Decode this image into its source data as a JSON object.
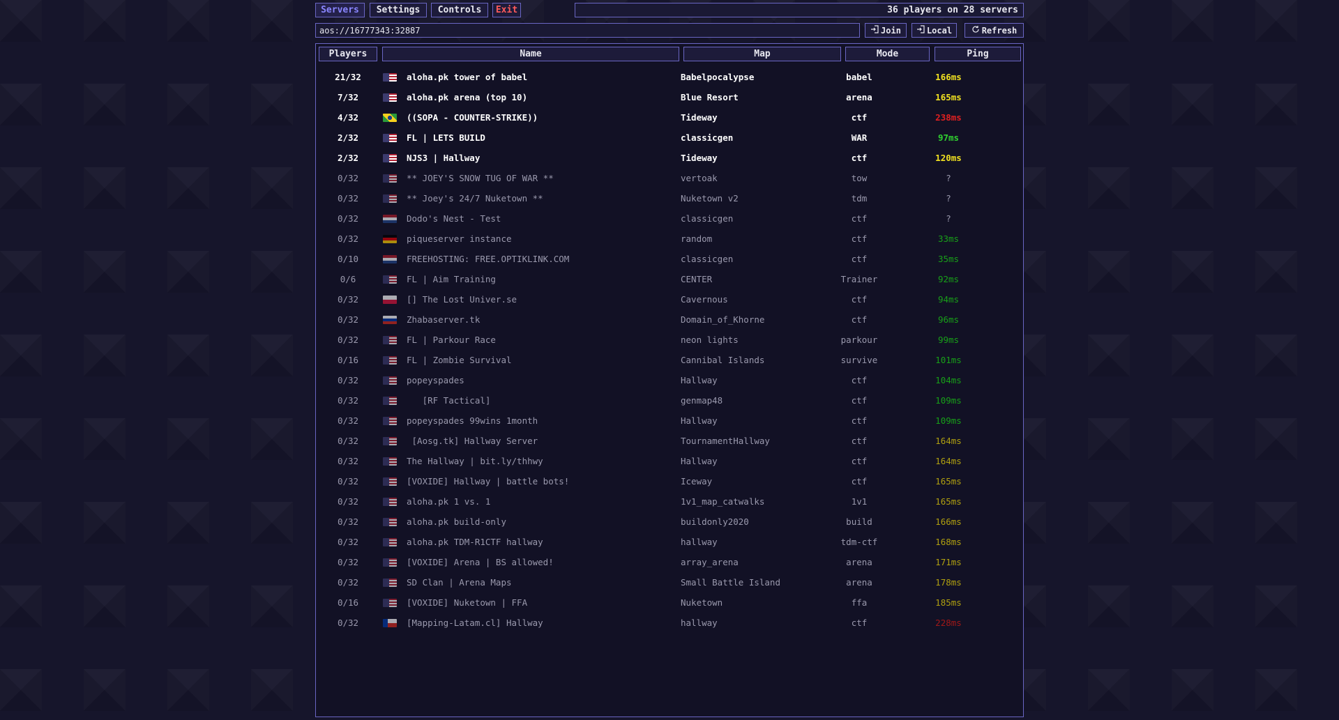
{
  "tabs": [
    {
      "label": "Servers",
      "active": true
    },
    {
      "label": "Settings",
      "active": false
    },
    {
      "label": "Controls",
      "active": false
    },
    {
      "label": "Exit",
      "active": false
    }
  ],
  "status_text": "36 players on 28 servers",
  "address": {
    "value": "aos://16777343:32887"
  },
  "actions": {
    "join": {
      "label": "Join",
      "icon": "login-icon"
    },
    "local": {
      "label": "Local",
      "icon": "login-icon"
    },
    "refresh": {
      "label": "Refresh",
      "icon": "refresh-icon"
    }
  },
  "columns": {
    "players": "Players",
    "name": "Name",
    "map": "Map",
    "mode": "Mode",
    "ping": "Ping"
  },
  "colors": {
    "accent": "#8a86ff",
    "border": "#6a66c4",
    "exit": "#ff5a5a",
    "ping_yellow": "#f0e020",
    "ping_red": "#e02020",
    "ping_green": "#20c020",
    "ping_dim_yellow": "#b0a010",
    "ping_dim_red": "#a01818",
    "ping_dim_green": "#18a018"
  },
  "servers": [
    {
      "players": "21/32",
      "flag": "us",
      "name": "aloha.pk tower of babel",
      "map": "Babelpocalypse",
      "mode": "babel",
      "ping": "166ms",
      "ping_color": "#f0e020",
      "active": true
    },
    {
      "players": "7/32",
      "flag": "us",
      "name": "aloha.pk arena (top 10)",
      "map": "Blue Resort",
      "mode": "arena",
      "ping": "165ms",
      "ping_color": "#f0e020",
      "active": true
    },
    {
      "players": "4/32",
      "flag": "br",
      "name": "((SOPA - COUNTER-STRIKE))",
      "map": "Tideway",
      "mode": "ctf",
      "ping": "238ms",
      "ping_color": "#e02020",
      "active": true
    },
    {
      "players": "2/32",
      "flag": "us",
      "name": "FL | LETS BUILD",
      "map": "classicgen",
      "mode": "WAR",
      "ping": "97ms",
      "ping_color": "#30d030",
      "active": true
    },
    {
      "players": "2/32",
      "flag": "us",
      "name": "NJS3 | Hallway",
      "map": "Tideway",
      "mode": "ctf",
      "ping": "120ms",
      "ping_color": "#f0e020",
      "active": true
    },
    {
      "players": "0/32",
      "flag": "us",
      "name": "** JOEY'S SNOW TUG OF WAR **",
      "map": "vertoak",
      "mode": "tow",
      "ping": "?",
      "ping_color": "#9a99ad",
      "active": false
    },
    {
      "players": "0/32",
      "flag": "us",
      "name": "** Joey's 24/7 Nuketown **",
      "map": "Nuketown v2",
      "mode": "tdm",
      "ping": "?",
      "ping_color": "#9a99ad",
      "active": false
    },
    {
      "players": "0/32",
      "flag": "nl",
      "name": "Dodo's Nest - Test",
      "map": "classicgen",
      "mode": "ctf",
      "ping": "?",
      "ping_color": "#9a99ad",
      "active": false
    },
    {
      "players": "0/32",
      "flag": "de",
      "name": "piqueserver instance",
      "map": "random",
      "mode": "ctf",
      "ping": "33ms",
      "ping_color": "#18a018",
      "active": false
    },
    {
      "players": "0/10",
      "flag": "nl",
      "name": "FREEHOSTING: FREE.OPTIKLINK.COM",
      "map": "classicgen",
      "mode": "ctf",
      "ping": "35ms",
      "ping_color": "#18a018",
      "active": false
    },
    {
      "players": "0/6",
      "flag": "us",
      "name": "FL | Aim Training",
      "map": "CENTER",
      "mode": "Trainer",
      "ping": "92ms",
      "ping_color": "#18a018",
      "active": false
    },
    {
      "players": "0/32",
      "flag": "pl",
      "name": "[] The Lost Univer.se",
      "map": "Cavernous",
      "mode": "ctf",
      "ping": "94ms",
      "ping_color": "#18a018",
      "active": false
    },
    {
      "players": "0/32",
      "flag": "ru",
      "name": "Zhabaserver.tk",
      "map": "Domain_of_Khorne",
      "mode": "ctf",
      "ping": "96ms",
      "ping_color": "#18a018",
      "active": false
    },
    {
      "players": "0/32",
      "flag": "us",
      "name": "FL | Parkour Race",
      "map": "neon lights",
      "mode": "parkour",
      "ping": "99ms",
      "ping_color": "#18a018",
      "active": false
    },
    {
      "players": "0/16",
      "flag": "us",
      "name": "FL | Zombie Survival",
      "map": "Cannibal Islands",
      "mode": "survive",
      "ping": "101ms",
      "ping_color": "#18a018",
      "active": false
    },
    {
      "players": "0/32",
      "flag": "us",
      "name": "popeyspades",
      "map": "Hallway",
      "mode": "ctf",
      "ping": "104ms",
      "ping_color": "#18a018",
      "active": false
    },
    {
      "players": "0/32",
      "flag": "us",
      "name": "   [RF Tactical]",
      "map": "genmap48",
      "mode": "ctf",
      "ping": "109ms",
      "ping_color": "#18a018",
      "active": false
    },
    {
      "players": "0/32",
      "flag": "us",
      "name": "popeyspades 99wins 1month",
      "map": "Hallway",
      "mode": "ctf",
      "ping": "109ms",
      "ping_color": "#18a018",
      "active": false
    },
    {
      "players": "0/32",
      "flag": "us",
      "name": " [Aosg.tk] Hallway Server",
      "map": "TournamentHallway",
      "mode": "ctf",
      "ping": "164ms",
      "ping_color": "#b0a010",
      "active": false
    },
    {
      "players": "0/32",
      "flag": "us",
      "name": "The Hallway | bit.ly/thhwy",
      "map": "Hallway",
      "mode": "ctf",
      "ping": "164ms",
      "ping_color": "#b0a010",
      "active": false
    },
    {
      "players": "0/32",
      "flag": "us",
      "name": "[VOXIDE] Hallway | battle bots!",
      "map": "Iceway",
      "mode": "ctf",
      "ping": "165ms",
      "ping_color": "#b0a010",
      "active": false
    },
    {
      "players": "0/32",
      "flag": "us",
      "name": "aloha.pk 1 vs. 1",
      "map": "1v1_map_catwalks",
      "mode": "1v1",
      "ping": "165ms",
      "ping_color": "#b0a010",
      "active": false
    },
    {
      "players": "0/32",
      "flag": "us",
      "name": "aloha.pk build-only",
      "map": "buildonly2020",
      "mode": "build",
      "ping": "166ms",
      "ping_color": "#b0a010",
      "active": false
    },
    {
      "players": "0/32",
      "flag": "us",
      "name": "aloha.pk TDM-R1CTF hallway",
      "map": "hallway",
      "mode": "tdm-ctf",
      "ping": "168ms",
      "ping_color": "#b0a010",
      "active": false
    },
    {
      "players": "0/32",
      "flag": "us",
      "name": "[VOXIDE] Arena | BS allowed!",
      "map": "array_arena",
      "mode": "arena",
      "ping": "171ms",
      "ping_color": "#b0a010",
      "active": false
    },
    {
      "players": "0/32",
      "flag": "us",
      "name": "SD Clan | Arena Maps",
      "map": "Small Battle Island",
      "mode": "arena",
      "ping": "178ms",
      "ping_color": "#b0a010",
      "active": false
    },
    {
      "players": "0/16",
      "flag": "us",
      "name": "[VOXIDE] Nuketown | FFA",
      "map": "Nuketown",
      "mode": "ffa",
      "ping": "185ms",
      "ping_color": "#b0a010",
      "active": false
    },
    {
      "players": "0/32",
      "flag": "cl",
      "name": "[Mapping-Latam.cl] Hallway",
      "map": "hallway",
      "mode": "ctf",
      "ping": "228ms",
      "ping_color": "#a01818",
      "active": false
    }
  ]
}
